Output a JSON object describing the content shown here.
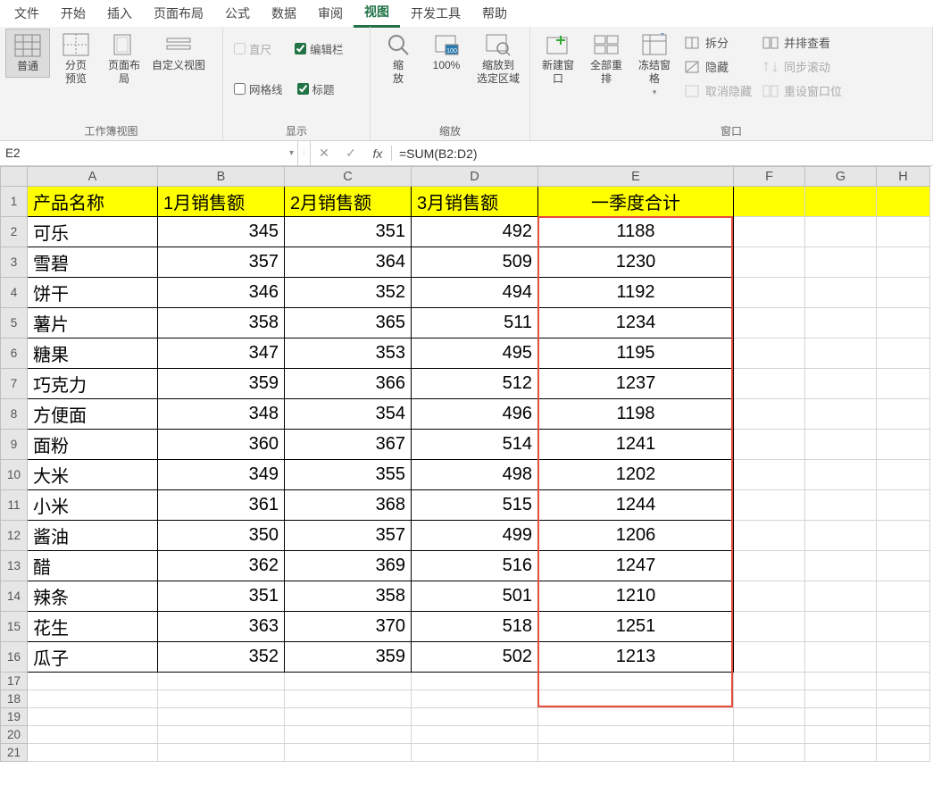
{
  "menu": {
    "items": [
      "文件",
      "开始",
      "插入",
      "页面布局",
      "公式",
      "数据",
      "审阅",
      "视图",
      "开发工具",
      "帮助"
    ],
    "active_index": 7
  },
  "ribbon": {
    "group_views": {
      "label": "工作簿视图",
      "normal": "普通",
      "page_break": "分页\n预览",
      "page_layout": "页面布局",
      "custom": "自定义视图"
    },
    "group_show": {
      "label": "显示",
      "ruler": "直尺",
      "gridlines": "网格线",
      "formula_bar": "编辑栏",
      "headings": "标题",
      "ruler_checked": false,
      "gridlines_checked": false,
      "formula_bar_checked": true,
      "headings_checked": true
    },
    "group_zoom": {
      "label": "缩放",
      "zoom": "缩\n放",
      "hundred": "100%",
      "zoom_selection": "缩放到\n选定区域"
    },
    "group_window": {
      "label": "窗口",
      "new": "新建窗口",
      "arrange": "全部重排",
      "freeze": "冻结窗格",
      "split": "拆分",
      "hide": "隐藏",
      "unhide": "取消隐藏",
      "side_by_side": "并排查看",
      "sync_scroll": "同步滚动",
      "reset_pos": "重设窗口位"
    }
  },
  "formula_bar": {
    "name_box": "E2",
    "formula": "=SUM(B2:D2)"
  },
  "columns": [
    "A",
    "B",
    "C",
    "D",
    "E",
    "F",
    "G",
    "H"
  ],
  "header_row": [
    "产品名称",
    "1月销售额",
    "2月销售额",
    "3月销售额",
    "一季度合计"
  ],
  "rows": [
    {
      "n": "可乐",
      "m": [
        345,
        351,
        492
      ],
      "t": 1188
    },
    {
      "n": "雪碧",
      "m": [
        357,
        364,
        509
      ],
      "t": 1230
    },
    {
      "n": "饼干",
      "m": [
        346,
        352,
        494
      ],
      "t": 1192
    },
    {
      "n": "薯片",
      "m": [
        358,
        365,
        511
      ],
      "t": 1234
    },
    {
      "n": "糖果",
      "m": [
        347,
        353,
        495
      ],
      "t": 1195
    },
    {
      "n": "巧克力",
      "m": [
        359,
        366,
        512
      ],
      "t": 1237
    },
    {
      "n": "方便面",
      "m": [
        348,
        354,
        496
      ],
      "t": 1198
    },
    {
      "n": "面粉",
      "m": [
        360,
        367,
        514
      ],
      "t": 1241
    },
    {
      "n": "大米",
      "m": [
        349,
        355,
        498
      ],
      "t": 1202
    },
    {
      "n": "小米",
      "m": [
        361,
        368,
        515
      ],
      "t": 1244
    },
    {
      "n": "酱油",
      "m": [
        350,
        357,
        499
      ],
      "t": 1206
    },
    {
      "n": "醋",
      "m": [
        362,
        369,
        516
      ],
      "t": 1247
    },
    {
      "n": "辣条",
      "m": [
        351,
        358,
        501
      ],
      "t": 1210
    },
    {
      "n": "花生",
      "m": [
        363,
        370,
        518
      ],
      "t": 1251
    },
    {
      "n": "瓜子",
      "m": [
        352,
        359,
        502
      ],
      "t": 1213
    }
  ],
  "empty_rows_after": [
    17,
    18,
    19,
    20,
    21
  ]
}
